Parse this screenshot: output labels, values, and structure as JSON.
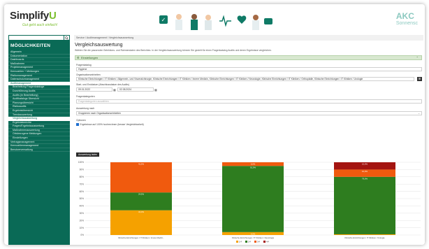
{
  "header": {
    "logo_text": "Simplify",
    "logo_accent": "U",
    "tagline": "Gut geht auch einfach!",
    "brand_line1": "AKC",
    "brand_line2": "Sonnensc"
  },
  "sidebar": {
    "title": "MÖGLICHKEITEN",
    "items": [
      {
        "label": "Allgemein",
        "sub": false
      },
      {
        "label": "Dokumentation",
        "sub": false
      },
      {
        "label": "Dashboards",
        "sub": false
      },
      {
        "label": "Maßnahmen",
        "sub": false
      },
      {
        "label": "Projektmanagement",
        "sub": false
      },
      {
        "label": "Kennzahlen + Meldungen",
        "sub": false
      },
      {
        "label": "Risikomanagement",
        "sub": false
      },
      {
        "label": "Datenschutzmanagement",
        "sub": false
      },
      {
        "label": "Auditmanagement",
        "sub": false,
        "active": true
      },
      {
        "label": "Bearbeitung Fragenkataloge",
        "sub": true
      },
      {
        "label": "Durchführung Audits",
        "sub": true
      },
      {
        "label": "Audits (in Bearbeitung)",
        "sub": true
      },
      {
        "label": "Auditkatalogs Übersicht",
        "sub": true
      },
      {
        "label": "Planungsübersicht",
        "sub": true
      },
      {
        "label": "Risikoaudits",
        "sub": true
      },
      {
        "label": "Ergebnisübersicht",
        "sub": true
      },
      {
        "label": "Trendauswertung",
        "sub": true
      },
      {
        "label": "Vergleichsauswertung",
        "sub": true,
        "active": true
      },
      {
        "label": "Ergebnisberichte",
        "sub": true
      },
      {
        "label": "Fragen/Ergebnisauswertung",
        "sub": true
      },
      {
        "label": "Maßnahmenauswertung",
        "sub": true
      },
      {
        "label": "Ortsbezogene Meldungen",
        "sub": true
      },
      {
        "label": "Einstellungen",
        "sub": true
      },
      {
        "label": "Vertragsmanagement",
        "sub": false
      },
      {
        "label": "Kennzahlenmanagement",
        "sub": false
      },
      {
        "label": "Benutzerverwaltung",
        "sub": false
      }
    ]
  },
  "main": {
    "breadcrumb": "Service  /  Auditmanagement  /  Vergleichsauswertung",
    "title": "Vergleichsauswertung",
    "description": "Wählen Sie die passenden Selektions- und Rahmendaten des Berichtes. In der Vergleichsauswertung können Sie gezielt für einen Fragenkatalog Audits und deren Ergebnisse vergleichen.",
    "settings_label": "Einstellungen",
    "fields": {
      "fragenkatalog_label": "Fragenkatalog",
      "fragenkatalog_value": "Hygiene",
      "org_label": "Organisationseinheiten",
      "org_value": "Klinische Einrichtungen / IT Kliniken / Allgemein- und Viszeralchirurgie, Klinische Einrichtungen / IT Kliniken / Innere Medizin, Klinische Einrichtungen / IT Kliniken / Neurologie, Klinische Einrichtungen / IT Kliniken / Orthopädie, Klinische Einrichtungen / IT Kliniken / Urologie",
      "period_label": "Start- und Enddatum (Abschlussdatum des Audits)",
      "start_date": "09.01.2022",
      "end_date": "02.08.2024",
      "fragenkategorien_label": "Fragenkategorien",
      "fragenkategorien_placeholder": "Fragenkategorien auswählen",
      "auswertung_label": "Auswertung nach",
      "auswertung_value": "Gruppieren nach Organisationseinheiten",
      "optionen_label": "Optionen",
      "option_checkbox": "Ergebnisse auf 100% hochrechnen (besser Vergleichbarkeit)"
    },
    "apply_button": "Auswertung laden"
  },
  "colors": {
    "sidebar_bg": "#0a6a56",
    "green": "#2e7d1f",
    "orange": "#f5a100",
    "deep_orange": "#f05a0e",
    "dark_red": "#a31410"
  },
  "chart_data": {
    "type": "bar",
    "stacked": true,
    "categories": [
      "Klinische Einrichtungen / IT Kliniken / Innere Medizi...",
      "Klinische Einrichtungen / IT Kliniken / Neurologie",
      "Klinische Einrichtungen / IT Kliniken / Urologie"
    ],
    "series": [
      {
        "name": "1/4",
        "color": "#f5a100",
        "values": [
          34.0,
          4.0,
          1.0
        ],
        "labels": [
          "34,0%",
          "4,0%",
          ""
        ]
      },
      {
        "name": "2/4",
        "color": "#2e7d1f",
        "values": [
          24.5,
          91.0,
          79.0
        ],
        "labels": [
          "24,5%",
          "91,0%",
          "79,0%"
        ]
      },
      {
        "name": "3/4",
        "color": "#f05a0e",
        "values": [
          41.5,
          5.0,
          10.0
        ],
        "labels": [
          "41,5%",
          "5,0%",
          "10,0%"
        ]
      },
      {
        "name": "4/4",
        "color": "#a31410",
        "values": [
          0,
          0,
          10.0
        ],
        "labels": [
          "",
          "",
          "10,0%"
        ]
      }
    ],
    "yticks": [
      "100%",
      "90%",
      "80%",
      "70%",
      "60%",
      "50%",
      "40%",
      "30%",
      "20%",
      "10%",
      "0%"
    ],
    "ylim": [
      0,
      100
    ],
    "legend_position": "bottom"
  }
}
